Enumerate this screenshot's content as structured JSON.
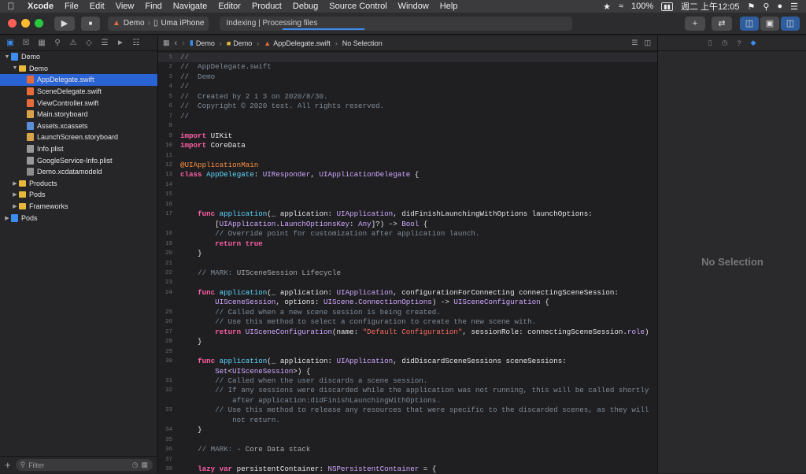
{
  "menubar": {
    "app": "Xcode",
    "items": [
      "File",
      "Edit",
      "View",
      "Find",
      "Navigate",
      "Editor",
      "Product",
      "Debug",
      "Source Control",
      "Window",
      "Help"
    ],
    "battery": "100%",
    "clock": "週二 上午12:05"
  },
  "toolbar": {
    "scheme": "Demo",
    "device": "Uma iPhone",
    "activity": "Indexing | Processing files",
    "progress": 0.28
  },
  "navigator": {
    "filter_placeholder": "Filter",
    "tree": [
      {
        "label": "Demo",
        "depth": 0,
        "icon": "proj",
        "open": true
      },
      {
        "label": "Demo",
        "depth": 1,
        "icon": "folder",
        "open": true
      },
      {
        "label": "AppDelegate.swift",
        "depth": 2,
        "icon": "swift",
        "selected": true
      },
      {
        "label": "SceneDelegate.swift",
        "depth": 2,
        "icon": "swift"
      },
      {
        "label": "ViewController.swift",
        "depth": 2,
        "icon": "swift"
      },
      {
        "label": "Main.storyboard",
        "depth": 2,
        "icon": "sb"
      },
      {
        "label": "Assets.xcassets",
        "depth": 2,
        "icon": "xca"
      },
      {
        "label": "LaunchScreen.storyboard",
        "depth": 2,
        "icon": "sb"
      },
      {
        "label": "Info.plist",
        "depth": 2,
        "icon": "plist"
      },
      {
        "label": "GoogleService-Info.plist",
        "depth": 2,
        "icon": "plist"
      },
      {
        "label": "Demo.xcdatamodeld",
        "depth": 2,
        "icon": "xcd"
      },
      {
        "label": "Products",
        "depth": 1,
        "icon": "folder",
        "open": false
      },
      {
        "label": "Pods",
        "depth": 1,
        "icon": "folder",
        "open": false
      },
      {
        "label": "Frameworks",
        "depth": 1,
        "icon": "folder",
        "open": false
      },
      {
        "label": "Pods",
        "depth": 0,
        "icon": "proj",
        "open": false
      }
    ]
  },
  "jumpbar": {
    "crumbs": [
      "Demo",
      "Demo",
      "AppDelegate.swift",
      "No Selection"
    ]
  },
  "code": {
    "current_line": 1,
    "lines": [
      {
        "n": "1",
        "html": "<span class=\"c\">//</span>"
      },
      {
        "n": "2",
        "html": "<span class=\"c\">//  AppDelegate.swift</span>"
      },
      {
        "n": "3",
        "html": "<span class=\"c\">//  Demo</span>"
      },
      {
        "n": "4",
        "html": "<span class=\"c\">//</span>"
      },
      {
        "n": "5",
        "html": "<span class=\"c\">//  Created by 2 1 3 on 2020/8/30.</span>"
      },
      {
        "n": "6",
        "html": "<span class=\"c\">//  Copyright © 2020 test. All rights reserved.</span>"
      },
      {
        "n": "7",
        "html": "<span class=\"c\">//</span>"
      },
      {
        "n": "8",
        "html": ""
      },
      {
        "n": "9",
        "html": "<span class=\"k\">import</span> UIKit"
      },
      {
        "n": "10",
        "html": "<span class=\"k\">import</span> CoreData"
      },
      {
        "n": "11",
        "html": ""
      },
      {
        "n": "12",
        "html": "<span class=\"a\">@UIApplicationMain</span>"
      },
      {
        "n": "13",
        "html": "<span class=\"k\">class</span> <span class=\"t\">AppDelegate</span>: <span class=\"ty\">UIResponder</span>, <span class=\"ty\">UIApplicationDelegate</span> {"
      },
      {
        "n": "14",
        "html": ""
      },
      {
        "n": "15",
        "html": ""
      },
      {
        "n": "16",
        "html": ""
      },
      {
        "n": "17",
        "html": "    <span class=\"k\">func</span> <span class=\"t\">application</span>(_ application: <span class=\"ty\">UIApplication</span>, didFinishLaunchingWithOptions launchOptions:"
      },
      {
        "n": "",
        "html": "        [<span class=\"ty\">UIApplication</span>.<span class=\"ty\">LaunchOptionsKey</span>: <span class=\"ty\">Any</span>]?) -> <span class=\"ty\">Bool</span> {"
      },
      {
        "n": "18",
        "html": "        <span class=\"c\">// Override point for customization after application launch.</span>"
      },
      {
        "n": "19",
        "html": "        <span class=\"k\">return</span> <span class=\"k\">true</span>"
      },
      {
        "n": "20",
        "html": "    }"
      },
      {
        "n": "21",
        "html": ""
      },
      {
        "n": "22",
        "html": "    <span class=\"c\">// MARK: </span><span class=\"m\">UISceneSession Lifecycle</span>"
      },
      {
        "n": "23",
        "html": ""
      },
      {
        "n": "24",
        "html": "    <span class=\"k\">func</span> <span class=\"t\">application</span>(_ application: <span class=\"ty\">UIApplication</span>, configurationForConnecting connectingSceneSession:"
      },
      {
        "n": "",
        "html": "        <span class=\"ty\">UISceneSession</span>, options: <span class=\"ty\">UIScene</span>.<span class=\"ty\">ConnectionOptions</span>) -> <span class=\"ty\">UISceneConfiguration</span> {"
      },
      {
        "n": "25",
        "html": "        <span class=\"c\">// Called when a new scene session is being created.</span>"
      },
      {
        "n": "26",
        "html": "        <span class=\"c\">// Use this method to select a configuration to create the new scene with.</span>"
      },
      {
        "n": "27",
        "html": "        <span class=\"k\">return</span> <span class=\"ty\">UISceneConfiguration</span>(name: <span class=\"s\">\"Default Configuration\"</span>, sessionRole: connectingSceneSession.<span class=\"ty\">role</span>)"
      },
      {
        "n": "28",
        "html": "    }"
      },
      {
        "n": "29",
        "html": ""
      },
      {
        "n": "30",
        "html": "    <span class=\"k\">func</span> <span class=\"t\">application</span>(_ application: <span class=\"ty\">UIApplication</span>, didDiscardSceneSessions sceneSessions:"
      },
      {
        "n": "",
        "html": "        <span class=\"ty\">Set</span>&lt;<span class=\"ty\">UISceneSession</span>&gt;) {"
      },
      {
        "n": "31",
        "html": "        <span class=\"c\">// Called when the user discards a scene session.</span>"
      },
      {
        "n": "32",
        "html": "        <span class=\"c\">// If any sessions were discarded while the application was not running, this will be called shortly</span>"
      },
      {
        "n": "",
        "html": "            <span class=\"c\">after application:didFinishLaunchingWithOptions.</span>"
      },
      {
        "n": "33",
        "html": "        <span class=\"c\">// Use this method to release any resources that were specific to the discarded scenes, as they will</span>"
      },
      {
        "n": "",
        "html": "            <span class=\"c\">not return.</span>"
      },
      {
        "n": "34",
        "html": "    }"
      },
      {
        "n": "35",
        "html": ""
      },
      {
        "n": "36",
        "html": "    <span class=\"c\">// MARK: </span><span class=\"m\">- Core Data stack</span>"
      },
      {
        "n": "37",
        "html": ""
      },
      {
        "n": "38",
        "html": "    <span class=\"k\">lazy var</span> persistentContainer: <span class=\"ty\">NSPersistentContainer</span> = {"
      }
    ]
  },
  "inspector": {
    "empty_label": "No Selection"
  }
}
